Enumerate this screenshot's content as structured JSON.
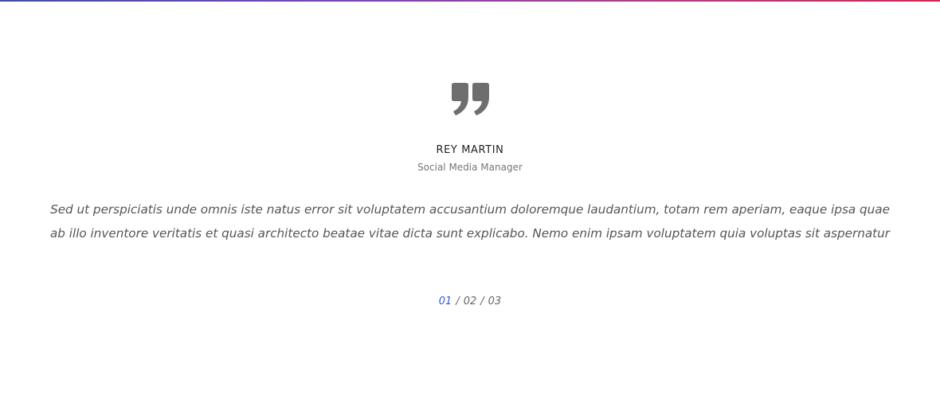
{
  "testimonial": {
    "quote_icon": "quote-right-icon",
    "author_name": "REY MARTIN",
    "author_role": "Social Media Manager",
    "text": "Sed ut perspiciatis unde omnis iste natus error sit voluptatem accusantium doloremque laudantium, totam rem aperiam, eaque ipsa quae ab illo inventore veritatis et quasi architecto beatae vitae dicta sunt explicabo. Nemo enim ipsam voluptatem quia voluptas sit aspernatur"
  },
  "pager": {
    "pages": [
      "01",
      "02",
      "03"
    ],
    "separator": "/",
    "active_index": 0
  },
  "colors": {
    "accent": "#2f5fd0",
    "gradient_start": "#3b4cc0",
    "gradient_end": "#f0174f",
    "text": "#555555",
    "icon": "#6e6e6e"
  }
}
